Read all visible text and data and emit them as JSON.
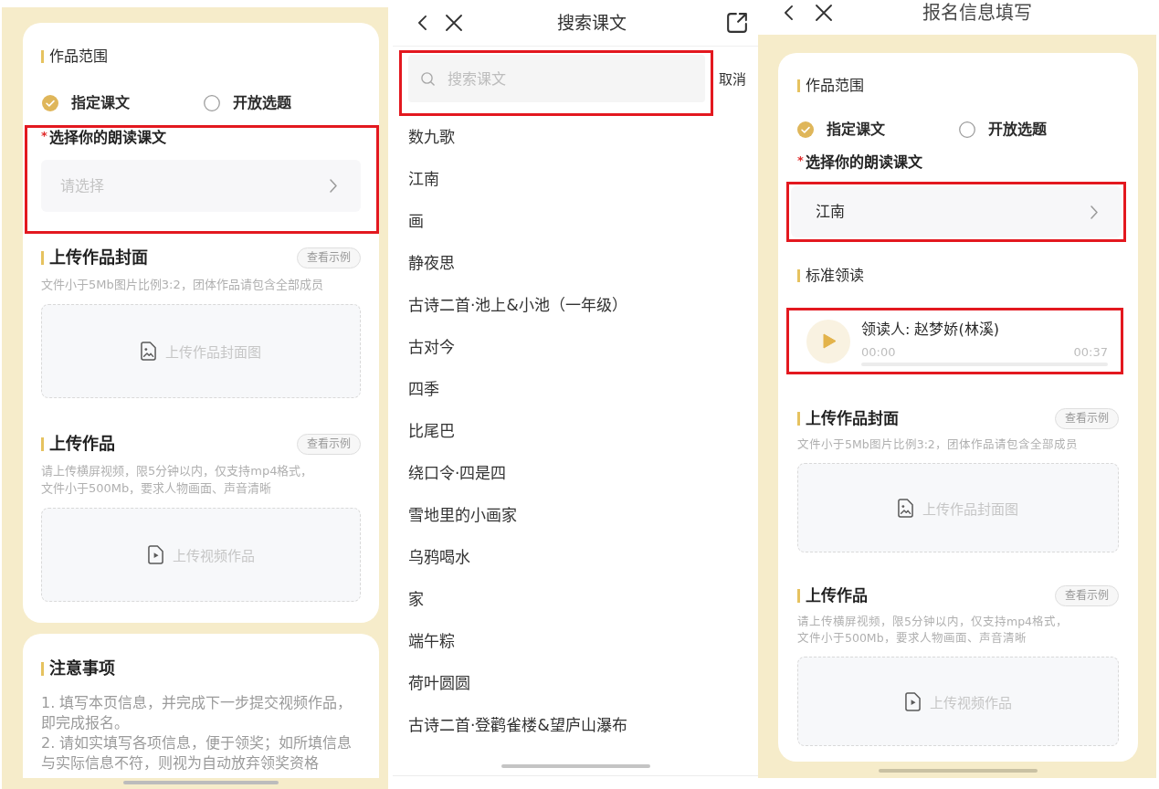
{
  "screens": [
    {
      "kind": "form",
      "cards": [
        {
          "blocks": [
            {
              "kind": "radio_group",
              "title": "作品范围",
              "options": [
                {
                  "label": "指定课文",
                  "selected": true
                },
                {
                  "label": "开放选题",
                  "selected": false
                }
              ]
            },
            {
              "kind": "select",
              "required_mark": "*",
              "label": "选择你的朗读课文",
              "placeholder": "请选择",
              "highlighted": true
            },
            {
              "kind": "image_upload",
              "title": "上传作品封面",
              "example_button": "查看示例",
              "hint_lines": [
                "文件小于5Mb图片比例3:2，团体作品请包含全部成员"
              ],
              "dropzone_label": "上传作品封面图"
            },
            {
              "kind": "video_upload",
              "title": "上传作品",
              "example_button": "查看示例",
              "hint_lines": [
                "请上传横屏视频，限5分钟以内，仅支持mp4格式，",
                "文件小于500Mb，要求人物画面、声音清晰"
              ],
              "dropzone_label": "上传视频作品"
            }
          ]
        },
        {
          "blocks": [
            {
              "kind": "notes",
              "title": "注意事项",
              "items": [
                "1. 填写本页信息，并完成下一步提交视频作品，即完成报名。",
                "2. 请如实填写各项信息，便于领奖；如所填信息与实际信息不符，则视为自动放弃领奖资格"
              ]
            }
          ]
        }
      ]
    },
    {
      "kind": "search",
      "nav": {
        "title": "搜索课文",
        "share_button": true
      },
      "search": {
        "placeholder": "搜索课文",
        "highlighted": true
      },
      "cancel_button": "取消",
      "results": [
        "数九歌",
        "江南",
        "画",
        "静夜思",
        "古诗二首·池上&小池（一年级）",
        "古对今",
        "四季",
        "比尾巴",
        "绕口令·四是四",
        "雪地里的小画家",
        "乌鸦喝水",
        "家",
        "端午粽",
        "荷叶圆圆",
        "古诗二首·登鹳雀楼&望庐山瀑布"
      ]
    },
    {
      "kind": "form",
      "nav": {
        "title": "报名信息填写"
      },
      "cards": [
        {
          "blocks": [
            {
              "kind": "radio_group",
              "title": "作品范围",
              "options": [
                {
                  "label": "指定课文",
                  "selected": true
                },
                {
                  "label": "开放选题",
                  "selected": false
                }
              ]
            },
            {
              "kind": "select",
              "required_mark": "*",
              "label": "选择你的朗读课文",
              "value": "江南",
              "field_highlighted": true
            },
            {
              "kind": "audio",
              "title": "标准领读",
              "reader": "领读人: 赵梦娇(林溪)",
              "elapsed": "00:00",
              "duration": "00:37",
              "level": 0,
              "highlighted": true
            },
            {
              "kind": "image_upload",
              "title": "上传作品封面",
              "example_button": "查看示例",
              "hint_lines": [
                "文件小于5Mb图片比例3:2，团体作品请包含全部成员"
              ],
              "dropzone_label": "上传作品封面图"
            },
            {
              "kind": "video_upload",
              "title": "上传作品",
              "example_button": "查看示例",
              "hint_lines": [
                "请上传横屏视频，限5分钟以内，仅支持mp4格式，",
                "文件小于500Mb，要求人物画面、声音清晰"
              ],
              "dropzone_label": "上传视频作品"
            }
          ]
        }
      ]
    }
  ]
}
